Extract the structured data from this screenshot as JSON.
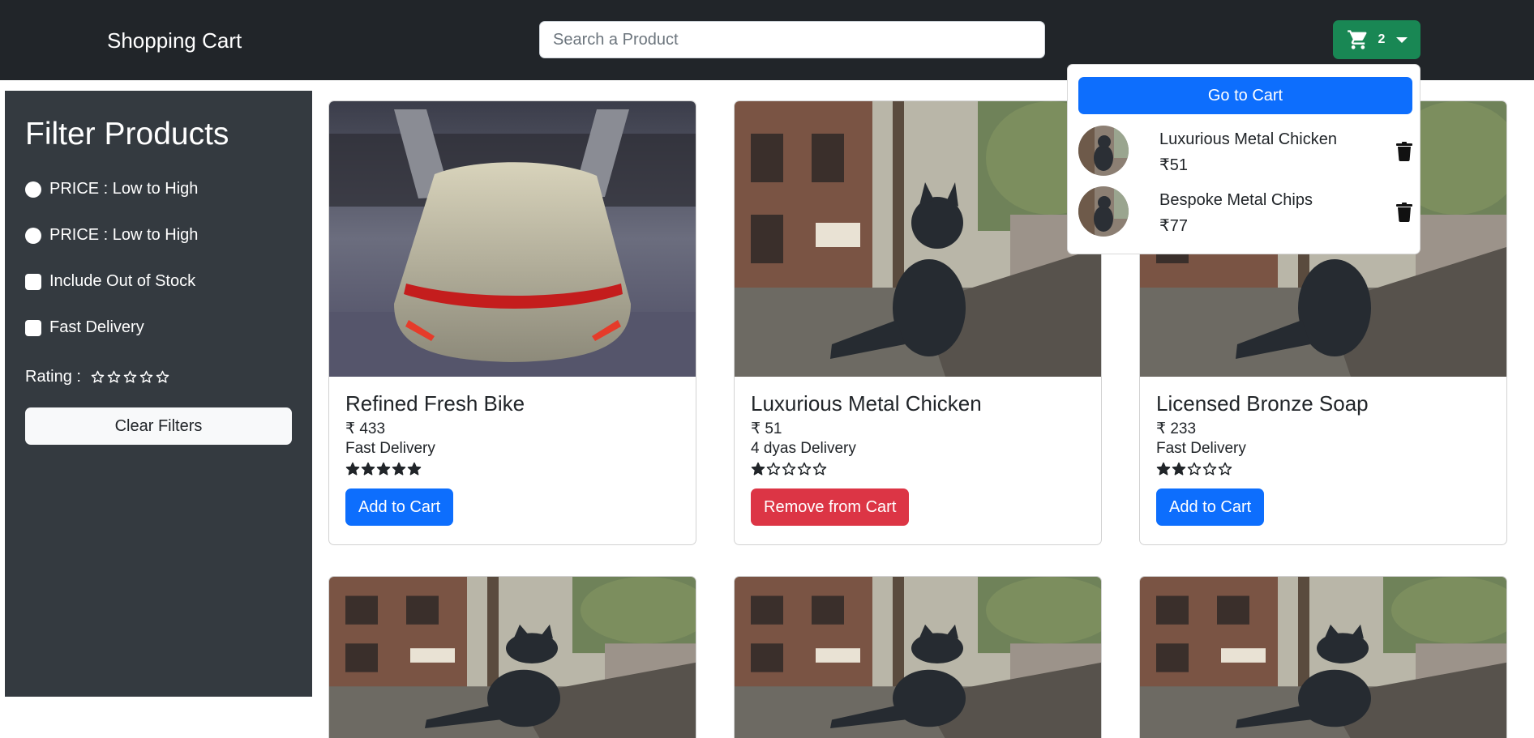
{
  "navbar": {
    "brand": "Shopping Cart",
    "search_placeholder": "Search a Product",
    "cart_count": "2"
  },
  "cart_dropdown": {
    "go_to_cart_label": "Go to Cart",
    "items": [
      {
        "name": "Luxurious Metal Chicken",
        "price": "₹51"
      },
      {
        "name": "Bespoke Metal Chips",
        "price": "₹77"
      }
    ]
  },
  "sidebar": {
    "title": "Filter Products",
    "options": [
      {
        "label": "PRICE : Low to High",
        "type": "radio",
        "checked": false
      },
      {
        "label": "PRICE : Low to High",
        "type": "radio",
        "checked": false
      },
      {
        "label": "Include Out of Stock",
        "type": "checkbox",
        "checked": false
      },
      {
        "label": "Fast Delivery",
        "type": "checkbox",
        "checked": false
      }
    ],
    "rating_label": "Rating :",
    "rating_value": 0,
    "rating_max": 5,
    "clear_label": "Clear Filters"
  },
  "products": [
    {
      "title": "Refined Fresh Bike",
      "price": "₹ 433",
      "delivery": "Fast Delivery",
      "rating": 5,
      "button": "Add to Cart",
      "in_cart": false,
      "image": "car"
    },
    {
      "title": "Luxurious Metal Chicken",
      "price": "₹ 51",
      "delivery": "4 dyas Delivery",
      "rating": 1,
      "button": "Remove from Cart",
      "in_cart": true,
      "image": "cat"
    },
    {
      "title": "Licensed Bronze Soap",
      "price": "₹ 233",
      "delivery": "Fast Delivery",
      "rating": 2,
      "button": "Add to Cart",
      "in_cart": false,
      "image": "cat"
    },
    {
      "image": "cat"
    },
    {
      "image": "cat"
    },
    {
      "image": "cat"
    }
  ],
  "colors": {
    "navbar": "#212529",
    "sidebar": "#343a40",
    "primary": "#0d6efd",
    "danger": "#dc3545",
    "success": "#198754"
  }
}
